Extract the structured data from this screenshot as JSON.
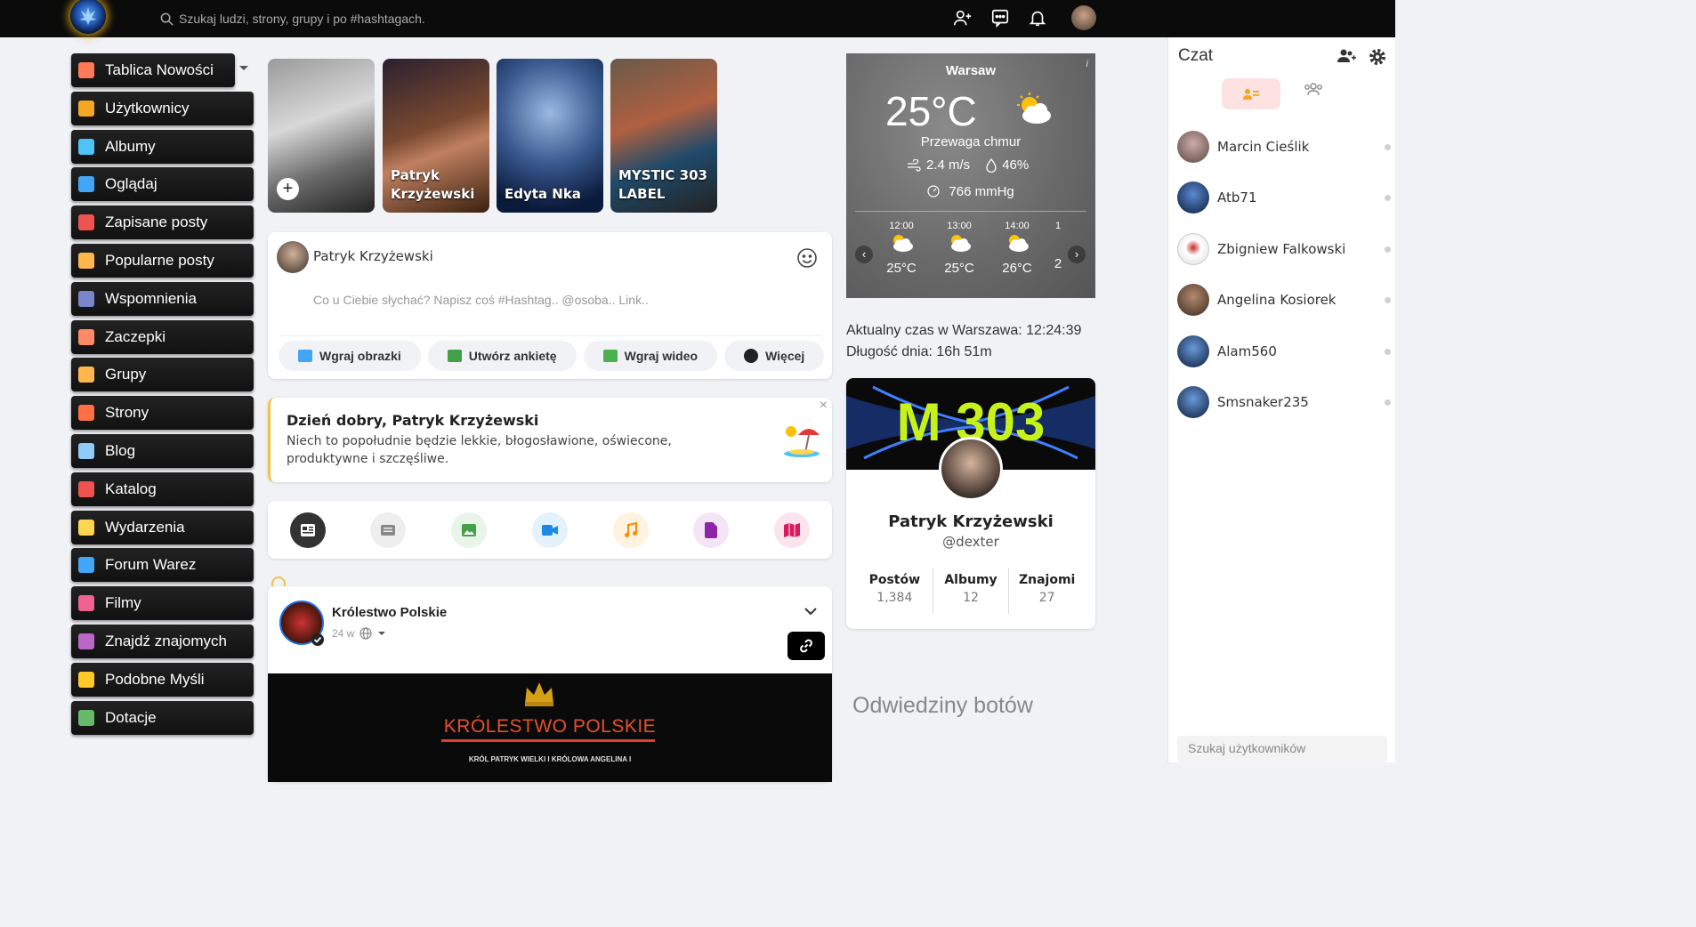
{
  "topbar": {
    "search_placeholder": "Szukaj ludzi, strony, grupy i po #hashtagach."
  },
  "menu": [
    {
      "label": "Tablica Nowości",
      "icon": "home-icon",
      "color": "#ff7a59"
    },
    {
      "label": "Użytkownicy",
      "icon": "users-icon",
      "color": "#f5a623"
    },
    {
      "label": "Albumy",
      "icon": "album-icon",
      "color": "#4fc3f7"
    },
    {
      "label": "Oglądaj",
      "icon": "video-icon",
      "color": "#42a5f5"
    },
    {
      "label": "Zapisane posty",
      "icon": "bookmark-icon",
      "color": "#ef5350"
    },
    {
      "label": "Popularne posty",
      "icon": "popular-icon",
      "color": "#ffb74d"
    },
    {
      "label": "Wspomnienia",
      "icon": "memories-icon",
      "color": "#7986cb"
    },
    {
      "label": "Zaczepki",
      "icon": "poke-icon",
      "color": "#ff8a65"
    },
    {
      "label": "Grupy",
      "icon": "groups-icon",
      "color": "#ffb74d"
    },
    {
      "label": "Strony",
      "icon": "pages-icon",
      "color": "#ff7043"
    },
    {
      "label": "Blog",
      "icon": "blog-icon",
      "color": "#90caf9"
    },
    {
      "label": "Katalog",
      "icon": "catalog-icon",
      "color": "#ef5350"
    },
    {
      "label": "Wydarzenia",
      "icon": "events-icon",
      "color": "#ffd54f"
    },
    {
      "label": "Forum Warez",
      "icon": "forum-icon",
      "color": "#42a5f5"
    },
    {
      "label": "Filmy",
      "icon": "film-icon",
      "color": "#f06292"
    },
    {
      "label": "Znajdź znajomych",
      "icon": "find-friends-icon",
      "color": "#ba68c8"
    },
    {
      "label": "Podobne Myśli",
      "icon": "puzzle-icon",
      "color": "#ffca28"
    },
    {
      "label": "Dotacje",
      "icon": "donate-icon",
      "color": "#66bb6a"
    }
  ],
  "stories": [
    {
      "label": "",
      "bg": "linear-gradient(160deg,#9a9a9a,#d8d8d8 40%,#6a6a6a 70%,#222)"
    },
    {
      "label": "Patryk Krzyżewski",
      "bg": "linear-gradient(160deg,#2a2030,#7a4a30 45%,#c08060 60%,#3a2010)"
    },
    {
      "label": "Edyta Nka",
      "bg": "radial-gradient(circle at 50% 35%,#9ab8e0,#3a5a90 45%,#0a1a3a 85%)"
    },
    {
      "label": "MYSTIC 303 LABEL",
      "bg": "linear-gradient(160deg,#6a5a4a,#b06040 40%,#204a6a 65%,#222)"
    }
  ],
  "composer": {
    "user": "Patryk Krzyżewski",
    "placeholder": "Co u Ciebie słychać? Napisz coś #Hashtag.. @osoba.. Link..",
    "actions": [
      {
        "label": "Wgraj obrazki",
        "icon": "image-icon",
        "color": "#42a5f5"
      },
      {
        "label": "Utwórz ankietę",
        "icon": "poll-icon",
        "color": "#43a047"
      },
      {
        "label": "Wgraj wideo",
        "icon": "camera-icon",
        "color": "#4caf50"
      },
      {
        "label": "Więcej",
        "icon": "plus-circle-icon",
        "color": "#222"
      }
    ]
  },
  "greeting": {
    "title": "Dzień dobry, Patryk Krzyżewski",
    "body": "Niech to popołudnie będzie lekkie, błogosławione, oświecone, produktywne i szczęśliwe.",
    "close": "×"
  },
  "filters": [
    {
      "icon": "news-feed-icon",
      "bg": "#333",
      "fg": "#fff"
    },
    {
      "icon": "text-icon",
      "bg": "#f0f0f0",
      "fg": "#888"
    },
    {
      "icon": "photo-icon",
      "bg": "#e8f5e9",
      "fg": "#43a047"
    },
    {
      "icon": "video-icon",
      "bg": "#e3f2fd",
      "fg": "#1e88e5"
    },
    {
      "icon": "music-icon",
      "bg": "#fff3e0",
      "fg": "#fb8c00"
    },
    {
      "icon": "file-icon",
      "bg": "#f3e5f5",
      "fg": "#8e24aa"
    },
    {
      "icon": "map-icon",
      "bg": "#fce4ec",
      "fg": "#d81b60"
    }
  ],
  "post": {
    "author": "Królestwo Polskie",
    "time": "24 w",
    "image_title": "KRÓLESTWO POLSKIE",
    "image_sub": "KRÓL PATRYK WIELKI I KRÓLOWA ANGELINA I"
  },
  "weather": {
    "city": "Warsaw",
    "info": "i",
    "temp": "25°C",
    "desc": "Przewaga chmur",
    "wind": "2.4 m/s",
    "humidity": "46%",
    "pressure": "766 mmHg",
    "hours": [
      {
        "time": "12:00",
        "temp": "25°C"
      },
      {
        "time": "13:00",
        "temp": "25°C"
      },
      {
        "time": "14:00",
        "temp": "26°C"
      },
      {
        "time": "1",
        "temp": "2"
      }
    ],
    "prev": "‹",
    "next": "›"
  },
  "time": {
    "label": "Aktualny czas w Warszawa:",
    "value": "12:24:39",
    "day_length": "Długość dnia: 16h 51m"
  },
  "profile": {
    "name": "Patryk Krzyżewski",
    "handle": "@dexter",
    "cover_text": "M 303",
    "stats": [
      {
        "label": "Postów",
        "value": "1,384"
      },
      {
        "label": "Albumy",
        "value": "12"
      },
      {
        "label": "Znajomi",
        "value": "27"
      }
    ]
  },
  "bots": "Odwiedziny botów",
  "chat": {
    "title": "Czat",
    "search_placeholder": "Szukaj użytkowników",
    "users": [
      {
        "name": "Marcin Cieślik",
        "bg": "radial-gradient(circle at 50% 40%,#caa,#5a4a40)"
      },
      {
        "name": "Atb71",
        "bg": "radial-gradient(circle at 50% 40%,#5a8ad0,#0a1a3a)"
      },
      {
        "name": "Zbigniew Falkowski",
        "bg": "radial-gradient(circle at 50% 45%,#c62828 0%,#ffffff 35%,#ddd 100%)"
      },
      {
        "name": "Angelina Kosiorek",
        "bg": "radial-gradient(circle at 50% 40%,#b58a70,#3a2a20)"
      },
      {
        "name": "Alam560",
        "bg": "radial-gradient(circle at 50% 40%,#6a9ad8,#0a1a3a)"
      },
      {
        "name": "Smsnaker235",
        "bg": "radial-gradient(circle at 50% 40%,#6a9ad8,#0a1a3a)"
      }
    ]
  }
}
